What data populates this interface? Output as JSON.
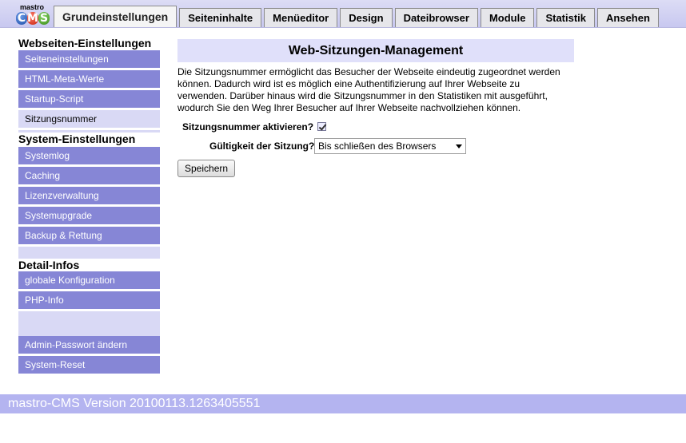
{
  "logo": {
    "top_text": "mastro",
    "letters": [
      "C",
      "M",
      "S"
    ]
  },
  "tabs": [
    {
      "label": "Grundeinstellungen",
      "active": true
    },
    {
      "label": "Seiteninhalte"
    },
    {
      "label": "Menüeditor"
    },
    {
      "label": "Design"
    },
    {
      "label": "Dateibrowser"
    },
    {
      "label": "Module"
    },
    {
      "label": "Statistik"
    },
    {
      "label": "Ansehen"
    }
  ],
  "sidebar": {
    "sections": [
      {
        "heading": "Webseiten-Einstellungen",
        "items": [
          "Seiteneinstellungen",
          "HTML-Meta-Werte",
          "Startup-Script",
          "Sitzungsnummer"
        ],
        "active_item": "Sitzungsnummer"
      },
      {
        "heading": "System-Einstellungen",
        "items": [
          "Systemlog",
          "Caching",
          "Lizenzverwaltung",
          "Systemupgrade",
          "Backup & Rettung"
        ]
      },
      {
        "heading": "Detail-Infos",
        "items": [
          "globale Konfiguration",
          "PHP-Info"
        ]
      },
      {
        "heading": "",
        "items": [
          "Admin-Passwort ändern",
          "System-Reset"
        ]
      }
    ]
  },
  "main": {
    "title": "Web-Sitzungen-Management",
    "description": "Die Sitzungsnummer ermöglicht das Besucher der Webseite eindeutig zugeordnet werden können. Dadurch wird ist es möglich eine Authentifizierung auf Ihrer Webseite zu verwenden. Darüber hinaus wird die Sitzungsnummer in den Statistiken mit ausgeführt, wodurch Sie den Weg Ihrer Besucher auf Ihrer Webseite nachvollziehen können.",
    "session_label": "Sitzungsnummer aktivieren?",
    "session_checked": true,
    "validity_label": "Gültigkeit der Sitzung?",
    "validity_value": "Bis schließen des Browsers",
    "save_label": "Speichern"
  },
  "footer": {
    "text": "mastro-CMS Version 20100113.1263405551"
  },
  "colors": {
    "sidebar_item": "#8686d6",
    "sidebar_active": "#d9d9f5",
    "title_bg": "#e0e0fa",
    "footer_bg": "#b4b4f0"
  }
}
